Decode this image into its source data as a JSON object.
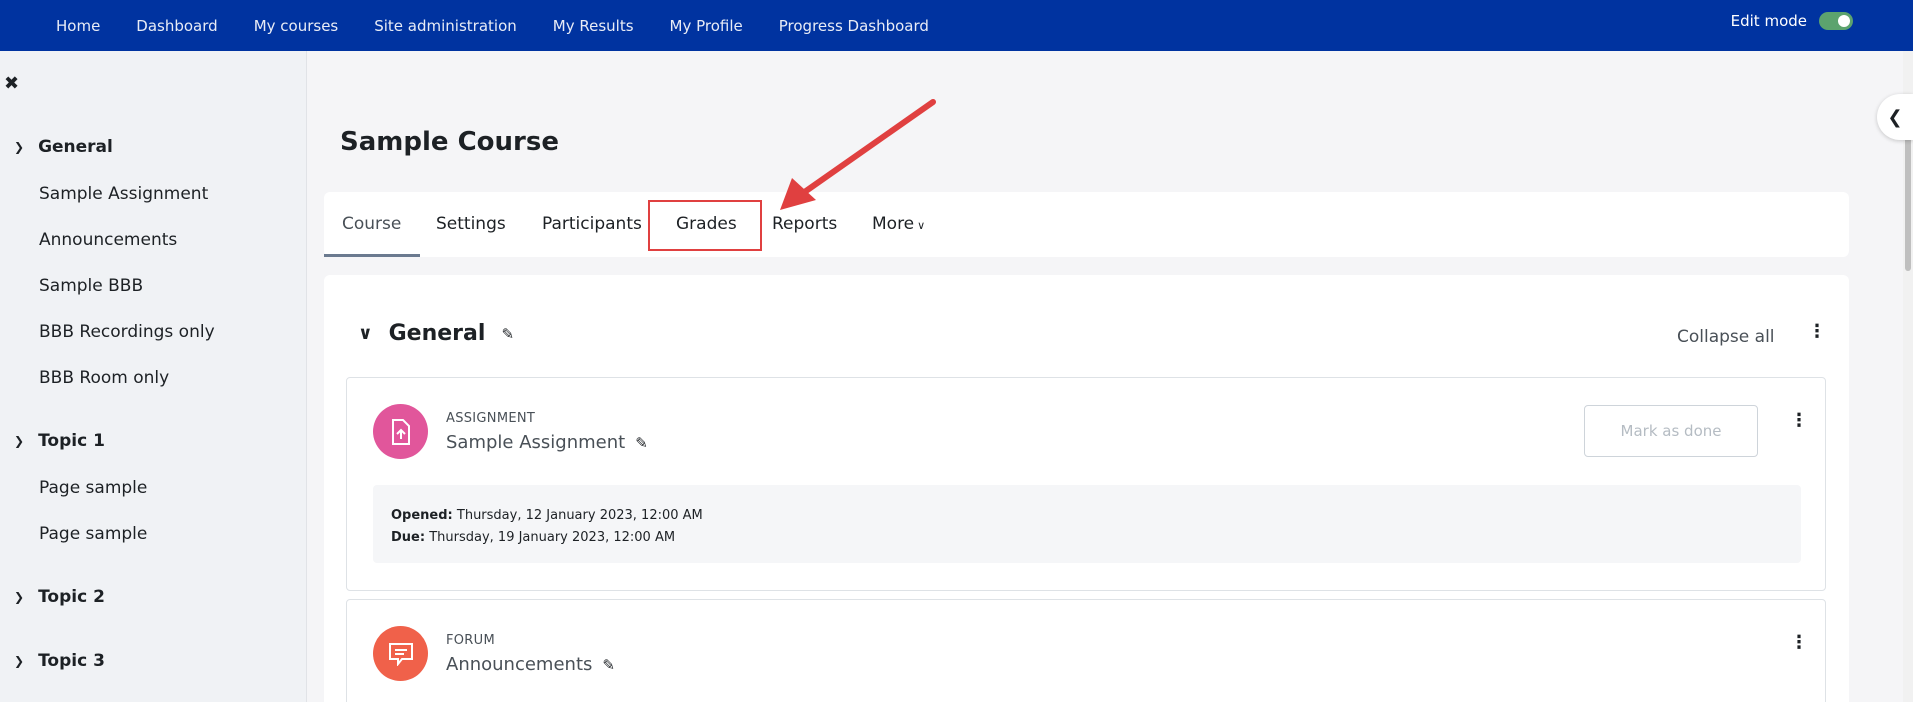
{
  "topnav": {
    "links": [
      "Home",
      "Dashboard",
      "My courses",
      "Site administration",
      "My Results",
      "My Profile",
      "Progress Dashboard"
    ],
    "edit_mode_label": "Edit mode",
    "edit_mode_on": true
  },
  "sidebar": {
    "close_glyph": "✖",
    "sections": [
      {
        "title": "General",
        "items": [
          "Sample Assignment",
          "Announcements",
          "Sample BBB",
          "BBB Recordings only",
          "BBB Room only"
        ]
      },
      {
        "title": "Topic 1",
        "items": [
          "Page sample",
          "Page sample"
        ]
      },
      {
        "title": "Topic 2",
        "items": []
      },
      {
        "title": "Topic 3",
        "items": []
      }
    ]
  },
  "course": {
    "title": "Sample Course",
    "tabs": [
      "Course",
      "Settings",
      "Participants",
      "Grades",
      "Reports",
      "More"
    ],
    "active_tab": "Course",
    "highlighted_tab": "Grades"
  },
  "section": {
    "title": "General",
    "collapse_all": "Collapse all"
  },
  "activities": [
    {
      "type": "ASSIGNMENT",
      "name": "Sample Assignment",
      "icon": "file-upload-icon",
      "icon_color": "#e1569b",
      "mark_done": "Mark as done",
      "opened_label": "Opened:",
      "opened_value": "Thursday, 12 January 2023, 12:00 AM",
      "due_label": "Due:",
      "due_value": "Thursday, 19 January 2023, 12:00 AM"
    },
    {
      "type": "FORUM",
      "name": "Announcements",
      "icon": "chat-bubble-icon",
      "icon_color": "#f0614a"
    }
  ],
  "colors": {
    "nav_bg": "#0033a0",
    "annotation_red": "#e04040"
  }
}
